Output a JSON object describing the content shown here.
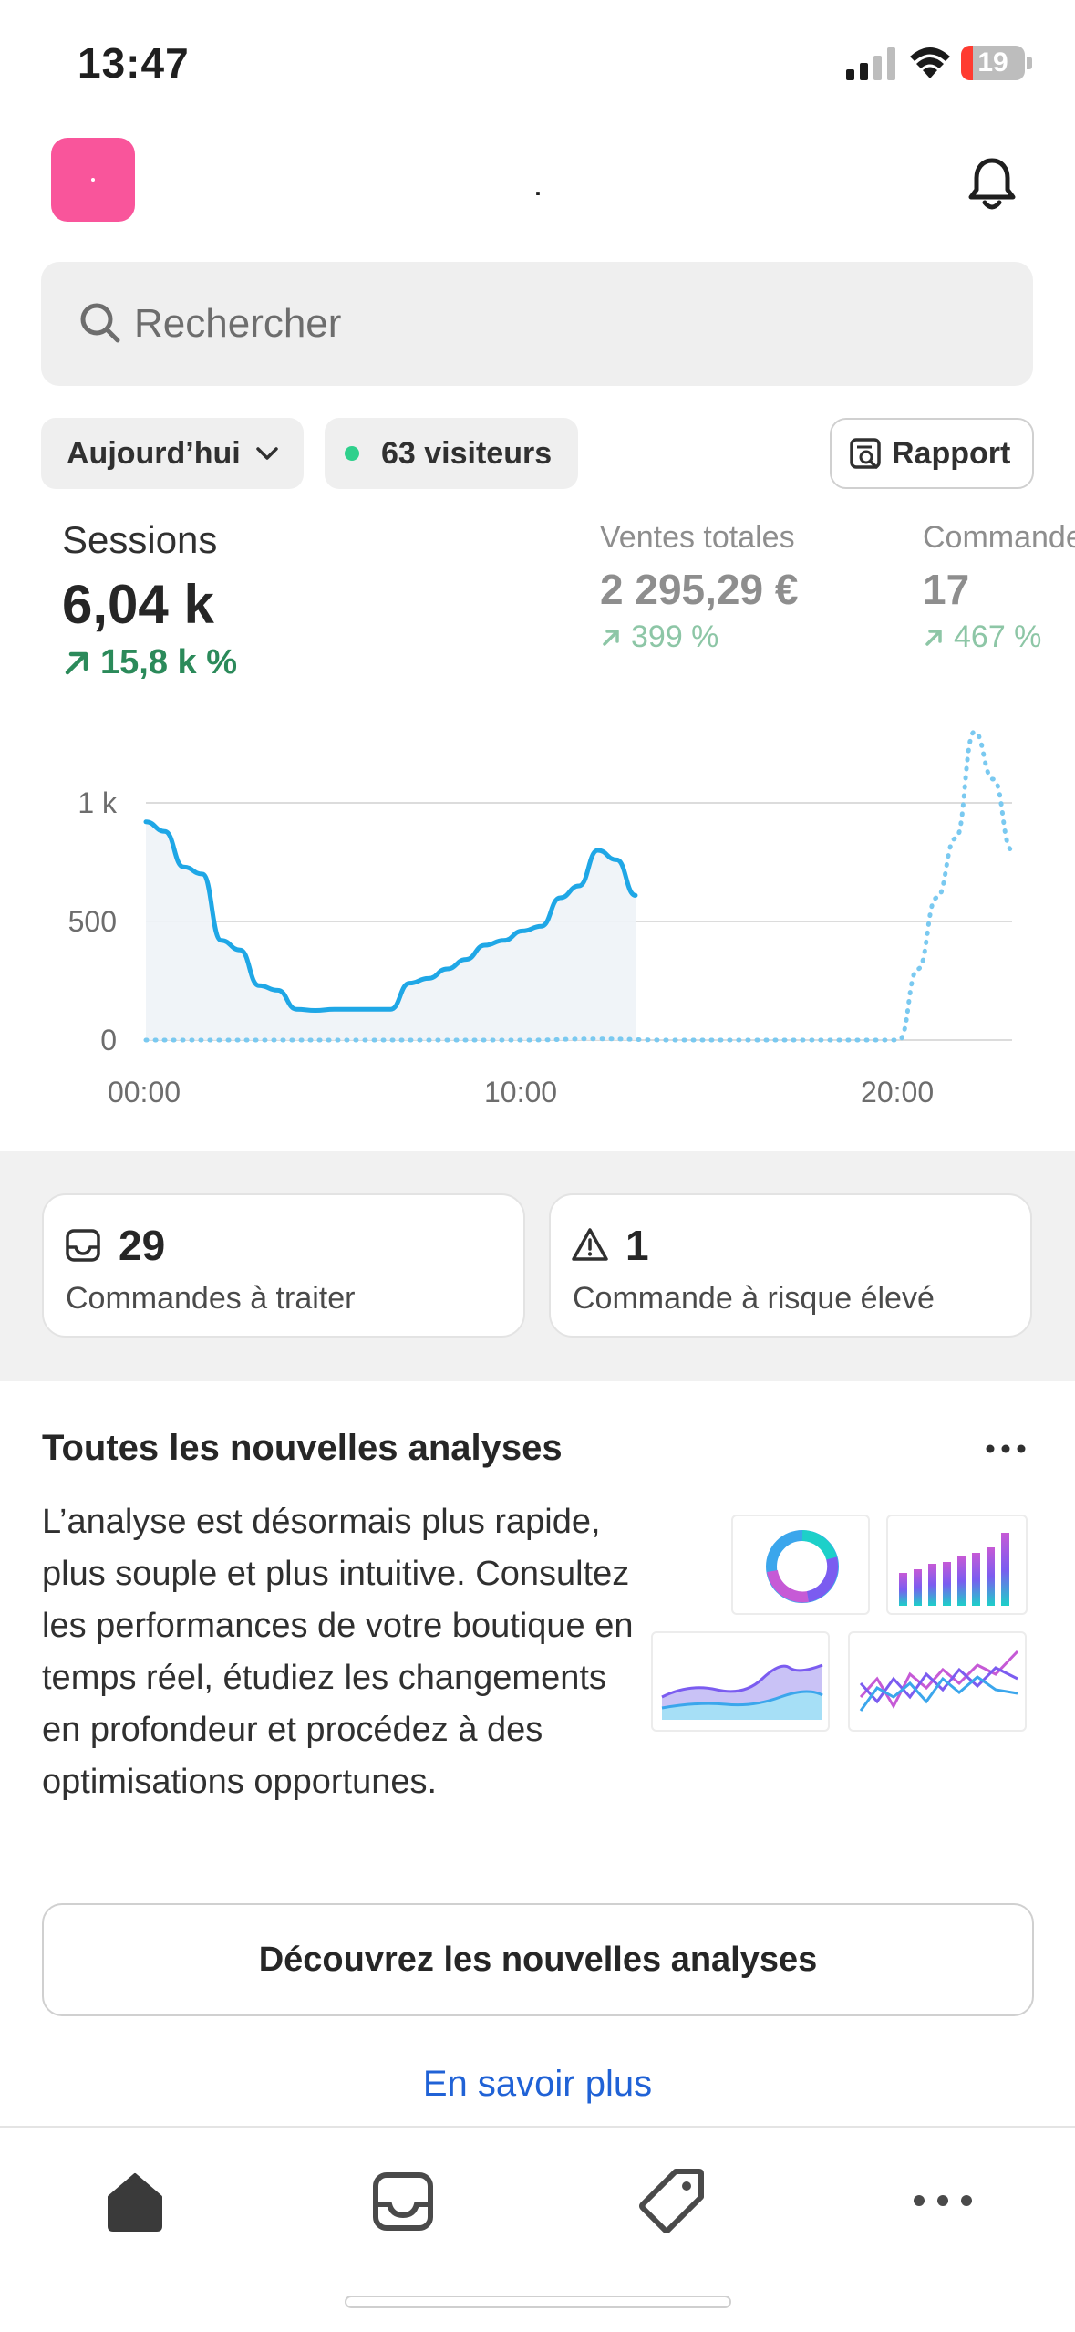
{
  "status_bar": {
    "time": "13:47",
    "battery_level": "19",
    "battery_fraction": 0.19,
    "battery_color": "#ff3b30"
  },
  "header": {
    "store_name": ".",
    "logo_color": "#f9559b"
  },
  "search": {
    "placeholder": "Rechercher"
  },
  "filters": {
    "date_label": "Aujourd’hui",
    "visitors_label": "63 visiteurs",
    "report_label": "Rapport"
  },
  "metrics": {
    "sessions": {
      "label": "Sessions",
      "value": "6,04 k",
      "delta": "15,8 k %"
    },
    "sales": {
      "label": "Ventes totales",
      "value": "2 295,29 €",
      "delta": "399 %"
    },
    "orders": {
      "label": "Commandes",
      "value": "17",
      "delta": "467 %"
    }
  },
  "chart_data": {
    "type": "line",
    "x_tick_labels": [
      "00:00",
      "10:00",
      "20:00"
    ],
    "y_tick_labels": [
      "0",
      "500",
      "1 k"
    ],
    "ylim": [
      0,
      1000
    ],
    "xlim": [
      0,
      23
    ],
    "grid": true,
    "series": [
      {
        "style": "solid",
        "color": "#1fa7e6",
        "x": [
          0,
          0.5,
          1,
          1.5,
          2,
          2.5,
          3,
          3.5,
          4,
          4.5,
          5,
          5.5,
          6,
          6.5,
          7,
          7.5,
          8,
          8.5,
          9,
          9.5,
          10,
          10.5,
          11,
          11.5,
          12,
          12.5,
          13
        ],
        "y": [
          920,
          880,
          730,
          700,
          420,
          380,
          230,
          210,
          130,
          125,
          130,
          130,
          130,
          130,
          240,
          260,
          300,
          340,
          400,
          420,
          460,
          480,
          600,
          650,
          800,
          760,
          610
        ]
      },
      {
        "style": "dotted",
        "color": "#7ac9f0",
        "x": [
          0,
          2,
          4,
          6,
          8,
          10,
          12,
          14,
          16,
          18,
          19,
          20,
          20.5,
          21,
          21.5,
          22,
          22.5,
          23
        ],
        "y": [
          0,
          0,
          0,
          0,
          0,
          0,
          5,
          0,
          0,
          0,
          0,
          0,
          300,
          600,
          850,
          1300,
          1100,
          800
        ]
      }
    ]
  },
  "tasks": {
    "to_process": {
      "count": "29",
      "label": "Commandes à traiter"
    },
    "high_risk": {
      "count": "1",
      "label": "Commande à risque élevé"
    }
  },
  "promo": {
    "title": "Toutes les nouvelles analyses",
    "body": "L’analyse est désormais plus rapide, plus souple et plus intuitive. Consultez les performances de votre boutique en temps réel, étudiez les changements en profondeur et procédez à des optimisations opportunes.",
    "cta_label": "Découvrez les nouvelles analyses",
    "link_label": "En savoir plus"
  },
  "tabbar": {
    "items": [
      "home-icon",
      "inbox-icon",
      "tag-icon",
      "more-icon"
    ]
  }
}
